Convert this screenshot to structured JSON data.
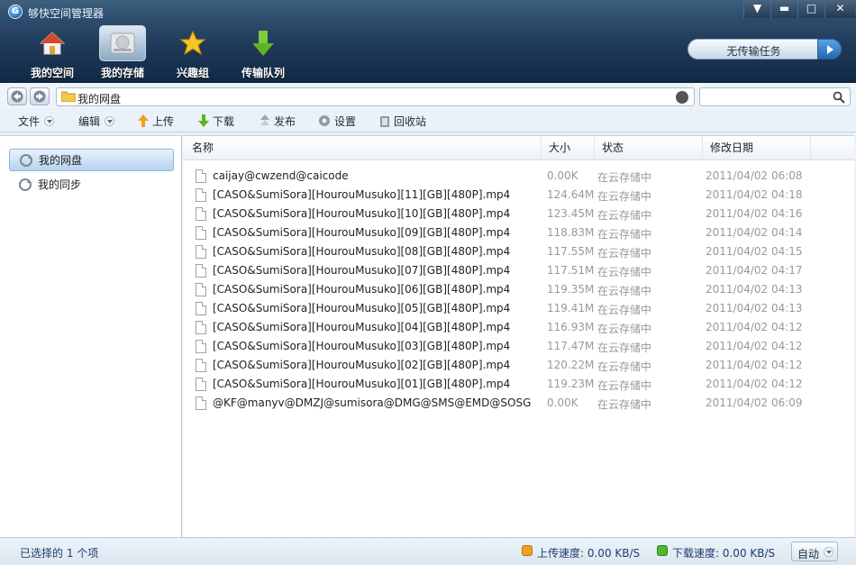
{
  "window": {
    "title": "够快空间管理器"
  },
  "nav": [
    {
      "label": "我的空间",
      "icon": "home-icon"
    },
    {
      "label": "我的存储",
      "icon": "hard-drive-icon"
    },
    {
      "label": "兴趣组",
      "icon": "star-icon"
    },
    {
      "label": "传输队列",
      "icon": "download-arrow-icon"
    }
  ],
  "task_button": {
    "label": "无传输任务"
  },
  "address": {
    "path": "我的网盘",
    "search_placeholder": ""
  },
  "toolbar": {
    "file": "文件",
    "edit": "编辑",
    "upload": "上传",
    "download": "下载",
    "publish": "发布",
    "settings": "设置",
    "recycle": "回收站"
  },
  "sidebar": {
    "items": [
      {
        "label": "我的网盘",
        "icon": "sync-icon"
      },
      {
        "label": "我的同步",
        "icon": "sync-icon"
      }
    ]
  },
  "table": {
    "headers": [
      "名称",
      "大小",
      "状态",
      "修改日期"
    ],
    "rows": [
      {
        "name": "caijay@cwzend@caicode",
        "size": "0.00K",
        "status": "在云存储中",
        "date": "2011/04/02 06:08"
      },
      {
        "name": "[CASO&SumiSora][HourouMusuko][11][GB][480P].mp4",
        "size": "124.64M",
        "status": "在云存储中",
        "date": "2011/04/02 04:18"
      },
      {
        "name": "[CASO&SumiSora][HourouMusuko][10][GB][480P].mp4",
        "size": "123.45M",
        "status": "在云存储中",
        "date": "2011/04/02 04:16"
      },
      {
        "name": "[CASO&SumiSora][HourouMusuko][09][GB][480P].mp4",
        "size": "118.83M",
        "status": "在云存储中",
        "date": "2011/04/02 04:14"
      },
      {
        "name": "[CASO&SumiSora][HourouMusuko][08][GB][480P].mp4",
        "size": "117.55M",
        "status": "在云存储中",
        "date": "2011/04/02 04:15"
      },
      {
        "name": "[CASO&SumiSora][HourouMusuko][07][GB][480P].mp4",
        "size": "117.51M",
        "status": "在云存储中",
        "date": "2011/04/02 04:17"
      },
      {
        "name": "[CASO&SumiSora][HourouMusuko][06][GB][480P].mp4",
        "size": "119.35M",
        "status": "在云存储中",
        "date": "2011/04/02 04:13"
      },
      {
        "name": "[CASO&SumiSora][HourouMusuko][05][GB][480P].mp4",
        "size": "119.41M",
        "status": "在云存储中",
        "date": "2011/04/02 04:13"
      },
      {
        "name": "[CASO&SumiSora][HourouMusuko][04][GB][480P].mp4",
        "size": "116.93M",
        "status": "在云存储中",
        "date": "2011/04/02 04:12"
      },
      {
        "name": "[CASO&SumiSora][HourouMusuko][03][GB][480P].mp4",
        "size": "117.47M",
        "status": "在云存储中",
        "date": "2011/04/02 04:12"
      },
      {
        "name": "[CASO&SumiSora][HourouMusuko][02][GB][480P].mp4",
        "size": "120.22M",
        "status": "在云存储中",
        "date": "2011/04/02 04:12"
      },
      {
        "name": "[CASO&SumiSora][HourouMusuko][01][GB][480P].mp4",
        "size": "119.23M",
        "status": "在云存储中",
        "date": "2011/04/02 04:12"
      },
      {
        "name": "@KF@manyv@DMZJ@sumisora@DMG@SMS@EMD@SOSG",
        "size": "0.00K",
        "status": "在云存储中",
        "date": "2011/04/02 06:09"
      }
    ]
  },
  "status": {
    "selection": "已选择的 1 个项",
    "upload_speed": "上传速度: 0.00 KB/S",
    "download_speed": "下载速度: 0.00 KB/S",
    "mode": "自动"
  },
  "colors": {
    "header_bg": "#1e3756",
    "accent": "#1f67b5",
    "selected": "#b7d3ee"
  }
}
